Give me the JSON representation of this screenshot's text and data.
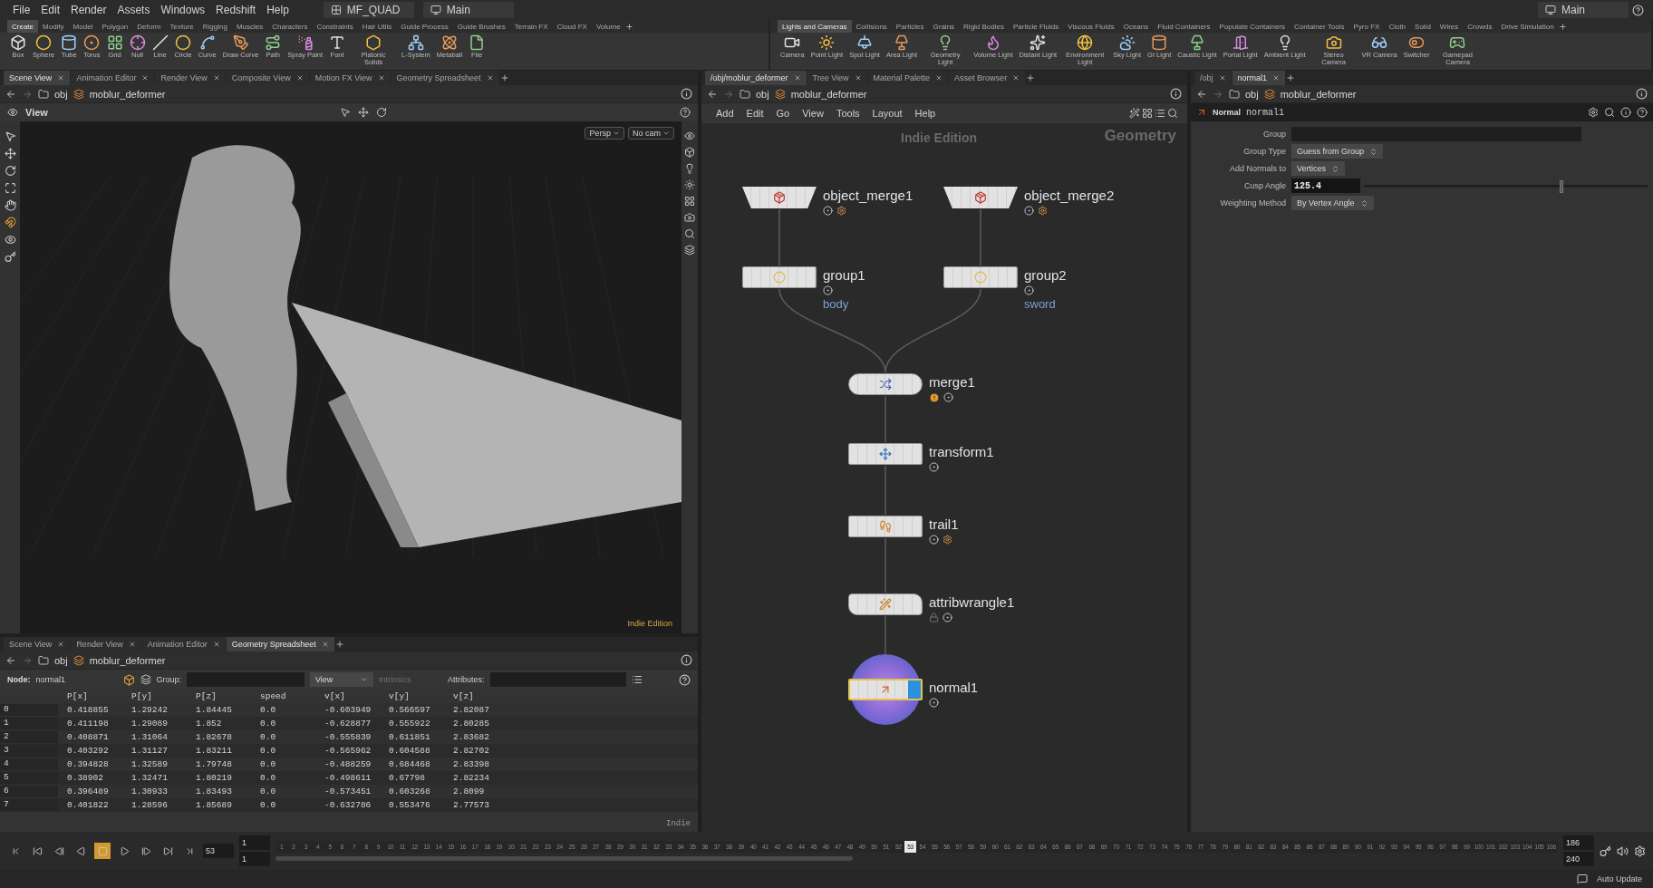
{
  "menu": [
    "File",
    "Edit",
    "Render",
    "Assets",
    "Windows",
    "Redshift",
    "Help"
  ],
  "desktops": [
    {
      "label": "MF_QUAD"
    },
    {
      "label": "Main"
    }
  ],
  "desktop_right": {
    "label": "Main"
  },
  "shelves": [
    {
      "tabs": [
        {
          "label": "Create",
          "selected": true
        },
        {
          "label": "Modify",
          "selected": false
        },
        {
          "label": "Model",
          "selected": false
        },
        {
          "label": "Polygon",
          "selected": false
        },
        {
          "label": "Deform",
          "selected": false
        },
        {
          "label": "Texture",
          "selected": false
        },
        {
          "label": "Rigging",
          "selected": false
        },
        {
          "label": "Muscles",
          "selected": false
        },
        {
          "label": "Characters",
          "selected": false
        },
        {
          "label": "Constraints",
          "selected": false
        },
        {
          "label": "Hair Utils",
          "selected": false
        },
        {
          "label": "Guide Process",
          "selected": false
        },
        {
          "label": "Guide Brushes",
          "selected": false
        },
        {
          "label": "Terrain FX",
          "selected": false
        },
        {
          "label": "Cloud FX",
          "selected": false
        },
        {
          "label": "Volume",
          "selected": false
        }
      ],
      "tools": [
        "Box",
        "Sphere",
        "Tube",
        "Torus",
        "Grid",
        "Null",
        "Line",
        "Circle",
        "Curve",
        "Draw Curve",
        "Path",
        "Spray Paint",
        "Font",
        "Platonic Solids",
        "L-System",
        "Metaball",
        "File"
      ]
    },
    {
      "tabs": [
        {
          "label": "Lights and Cameras",
          "selected": true
        },
        {
          "label": "Collisions",
          "selected": false
        },
        {
          "label": "Particles",
          "selected": false
        },
        {
          "label": "Grains",
          "selected": false
        },
        {
          "label": "Rigid Bodies",
          "selected": false
        },
        {
          "label": "Particle Fluids",
          "selected": false
        },
        {
          "label": "Viscous Fluids",
          "selected": false
        },
        {
          "label": "Oceans",
          "selected": false
        },
        {
          "label": "Fluid Containers",
          "selected": false
        },
        {
          "label": "Populate Containers",
          "selected": false
        },
        {
          "label": "Container Tools",
          "selected": false
        },
        {
          "label": "Pyro FX",
          "selected": false
        },
        {
          "label": "Cloth",
          "selected": false
        },
        {
          "label": "Solid",
          "selected": false
        },
        {
          "label": "Wires",
          "selected": false
        },
        {
          "label": "Crowds",
          "selected": false
        },
        {
          "label": "Drive Simulation",
          "selected": false
        }
      ],
      "tools": [
        "Camera",
        "Point Light",
        "Spot Light",
        "Area Light",
        "Geometry Light",
        "Volume Light",
        "Distant Light",
        "Environment Light",
        "Sky Light",
        "GI Light",
        "Caustic Light",
        "Portal Light",
        "Ambient Light",
        "Stereo Camera",
        "VR Camera",
        "Switcher",
        "Gamepad Camera"
      ]
    }
  ],
  "scene_view": {
    "tabs": [
      {
        "label": "Scene View",
        "selected": true
      },
      {
        "label": "Animation Editor",
        "selected": false
      },
      {
        "label": "Render View",
        "selected": false
      },
      {
        "label": "Composite View",
        "selected": false
      },
      {
        "label": "Motion FX View",
        "selected": false
      },
      {
        "label": "Geometry Spreadsheet",
        "selected": false
      }
    ],
    "path": [
      "obj",
      "moblur_deformer"
    ],
    "title": "View",
    "camera_buttons": [
      "Persp",
      "No cam"
    ],
    "edition": "Indie Edition"
  },
  "spreadsheet": {
    "tabs": [
      {
        "label": "Scene View",
        "selected": false
      },
      {
        "label": "Render View",
        "selected": false
      },
      {
        "label": "Animation Editor",
        "selected": false
      },
      {
        "label": "Geometry Spreadsheet",
        "selected": true
      }
    ],
    "path": [
      "obj",
      "moblur_deformer"
    ],
    "node_label": "Node:",
    "node": "normal1",
    "group_label": "Group:",
    "view_menu": "View",
    "intrinsics": {
      "label": "Intrinsics",
      "disabled": true
    },
    "attributes_label": "Attributes:",
    "columns": [
      "P[x]",
      "P[y]",
      "P[z]",
      "speed",
      "v[x]",
      "v[y]",
      "v[z]"
    ],
    "rows": [
      {
        "index": "0",
        "values": [
          "0.418855",
          "1.29242",
          "1.84445",
          "0.0",
          "-0.603949",
          "0.566597",
          "2.82087"
        ]
      },
      {
        "index": "1",
        "values": [
          "0.411198",
          "1.29089",
          "1.852",
          "0.0",
          "-0.628877",
          "0.555922",
          "2.80285"
        ]
      },
      {
        "index": "2",
        "values": [
          "0.408871",
          "1.31064",
          "1.82678",
          "0.0",
          "-0.555839",
          "0.611851",
          "2.83682"
        ]
      },
      {
        "index": "3",
        "values": [
          "0.403292",
          "1.31127",
          "1.83211",
          "0.0",
          "-0.565962",
          "0.604588",
          "2.82702"
        ]
      },
      {
        "index": "4",
        "values": [
          "0.394828",
          "1.32589",
          "1.79748",
          "0.0",
          "-0.488259",
          "0.684468",
          "2.83398"
        ]
      },
      {
        "index": "5",
        "values": [
          "0.38902",
          "1.32471",
          "1.80219",
          "0.0",
          "-0.498611",
          "0.67798",
          "2.82234"
        ]
      },
      {
        "index": "6",
        "values": [
          "0.396489",
          "1.30933",
          "1.83493",
          "0.0",
          "-0.573451",
          "0.603268",
          "2.8099"
        ]
      },
      {
        "index": "7",
        "values": [
          "0.401822",
          "1.28596",
          "1.85689",
          "0.0",
          "-0.632786",
          "0.553476",
          "2.77573"
        ]
      }
    ],
    "edition": "Indie"
  },
  "network": {
    "tabs": [
      {
        "label": "/obj/moblur_deformer",
        "selected": true
      },
      {
        "label": "Tree View",
        "selected": false
      },
      {
        "label": "Material Palette",
        "selected": false
      },
      {
        "label": "Asset Browser",
        "selected": false
      }
    ],
    "path": [
      "obj",
      "moblur_deformer"
    ],
    "menu": [
      "Add",
      "Edit",
      "Go",
      "View",
      "Tools",
      "Layout",
      "Help"
    ],
    "edition": "Indie Edition",
    "context": "Geometry",
    "nodes": [
      {
        "name": "object_merge1",
        "kind": "trapezoid",
        "time_dependent": true,
        "warning": false,
        "locked": false,
        "selected": false
      },
      {
        "name": "object_merge2",
        "kind": "trapezoid",
        "time_dependent": true,
        "warning": false,
        "locked": false,
        "selected": false
      },
      {
        "name": "group1",
        "kind": "box",
        "comment": "body",
        "time_dependent": false,
        "warning": false,
        "locked": false,
        "selected": false
      },
      {
        "name": "group2",
        "kind": "box",
        "comment": "sword",
        "time_dependent": false,
        "warning": false,
        "locked": false,
        "selected": false
      },
      {
        "name": "merge1",
        "kind": "merge",
        "time_dependent": false,
        "warning": true,
        "locked": false,
        "selected": false
      },
      {
        "name": "transform1",
        "kind": "box",
        "time_dependent": false,
        "warning": false,
        "locked": false,
        "selected": false
      },
      {
        "name": "trail1",
        "kind": "box",
        "time_dependent": true,
        "warning": false,
        "locked": false,
        "selected": false
      },
      {
        "name": "attribwrangle1",
        "kind": "wave",
        "time_dependent": false,
        "warning": false,
        "locked": true,
        "selected": false
      },
      {
        "name": "normal1",
        "kind": "box",
        "time_dependent": false,
        "warning": false,
        "locked": false,
        "selected": true
      }
    ]
  },
  "parameters": {
    "tabs": [
      {
        "label": "/obj",
        "selected": false
      },
      {
        "label": "normal1",
        "selected": true
      }
    ],
    "path": [
      "obj",
      "moblur_deformer"
    ],
    "node_type": "Normal",
    "node_name": "normal1",
    "params": [
      {
        "kind": "text",
        "label": "Group"
      },
      {
        "kind": "menu",
        "label": "Group Type",
        "value": "Guess from Group"
      },
      {
        "kind": "menu",
        "label": "Add Normals to",
        "value": "Vertices"
      },
      {
        "kind": "slider",
        "label": "Cusp Angle",
        "value": "125.4",
        "level": 0.69
      },
      {
        "kind": "menu",
        "label": "Weighting Method",
        "value": "By Vertex Angle"
      }
    ]
  },
  "timeline": {
    "stopped": true,
    "frame": "53",
    "start": [
      "1",
      "1"
    ],
    "end": [
      "186",
      "240"
    ],
    "ticks_before": [
      "1",
      "2",
      "3",
      "4",
      "5",
      "6",
      "7",
      "8",
      "9",
      "10",
      "11",
      "12",
      "13",
      "14",
      "15",
      "16",
      "17",
      "18",
      "19",
      "20",
      "21",
      "22",
      "23",
      "24",
      "25",
      "26",
      "27",
      "28",
      "29",
      "30",
      "31",
      "32",
      "33",
      "34",
      "35",
      "36",
      "37",
      "38",
      "39",
      "40",
      "41",
      "42",
      "43",
      "44",
      "45",
      "46",
      "47",
      "48",
      "49",
      "50",
      "51",
      "52"
    ],
    "current_tick": "53",
    "ticks_after": [
      "54",
      "55",
      "56",
      "57",
      "58",
      "59",
      "60",
      "61",
      "62",
      "63",
      "64",
      "65",
      "66",
      "67",
      "68",
      "69",
      "70",
      "71",
      "72",
      "73",
      "74",
      "75",
      "76",
      "77",
      "78",
      "79",
      "80",
      "81",
      "82",
      "83",
      "84",
      "85",
      "86",
      "87",
      "88",
      "89",
      "90",
      "91",
      "92",
      "93",
      "94",
      "95",
      "96",
      "97",
      "98",
      "99",
      "100",
      "101",
      "102",
      "103",
      "104",
      "105",
      "106"
    ]
  },
  "status_bar": {
    "text": "Auto Update"
  }
}
